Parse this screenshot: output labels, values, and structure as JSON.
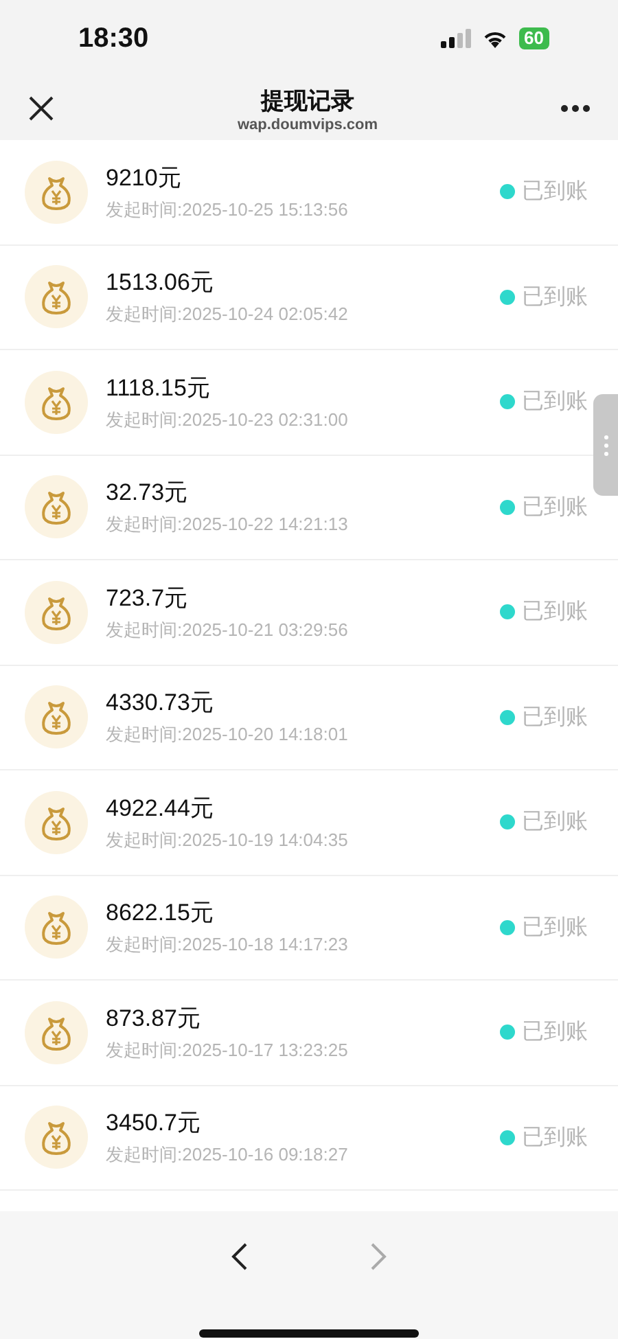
{
  "status_bar": {
    "time": "18:30",
    "battery": "60"
  },
  "nav": {
    "title": "提现记录",
    "url": "wap.doumvips.com"
  },
  "records": [
    {
      "amount": "9210元",
      "time": "发起时间:2025-10-25 15:13:56",
      "status": "已到账"
    },
    {
      "amount": "1513.06元",
      "time": "发起时间:2025-10-24 02:05:42",
      "status": "已到账"
    },
    {
      "amount": "1118.15元",
      "time": "发起时间:2025-10-23 02:31:00",
      "status": "已到账"
    },
    {
      "amount": "32.73元",
      "time": "发起时间:2025-10-22 14:21:13",
      "status": "已到账"
    },
    {
      "amount": "723.7元",
      "time": "发起时间:2025-10-21 03:29:56",
      "status": "已到账"
    },
    {
      "amount": "4330.73元",
      "time": "发起时间:2025-10-20 14:18:01",
      "status": "已到账"
    },
    {
      "amount": "4922.44元",
      "time": "发起时间:2025-10-19 14:04:35",
      "status": "已到账"
    },
    {
      "amount": "8622.15元",
      "time": "发起时间:2025-10-18 14:17:23",
      "status": "已到账"
    },
    {
      "amount": "873.87元",
      "time": "发起时间:2025-10-17 13:23:25",
      "status": "已到账"
    },
    {
      "amount": "3450.7元",
      "time": "发起时间:2025-10-16 09:18:27",
      "status": "已到账"
    }
  ],
  "toolbar": {
    "back": {
      "disabled": false
    },
    "forward": {
      "disabled": true
    }
  }
}
